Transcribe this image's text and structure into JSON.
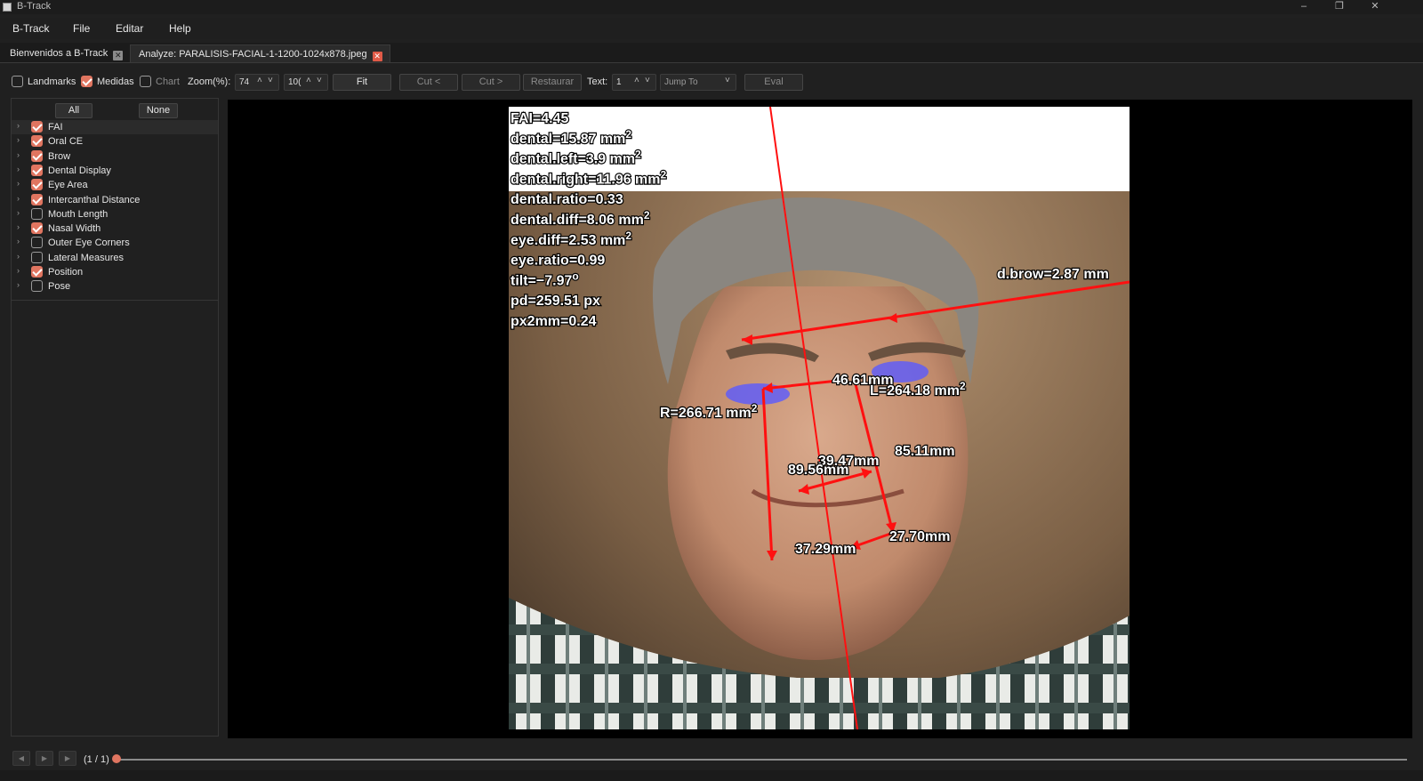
{
  "window": {
    "title": "B-Track",
    "minimize_glyph": "–",
    "restore_glyph": "❐",
    "close_glyph": "✕"
  },
  "menu": [
    "B-Track",
    "File",
    "Editar",
    "Help"
  ],
  "tabs": [
    {
      "label": "Bienvenidos a B-Track",
      "close_glyph": "✕"
    },
    {
      "label": "Analyze: PARALISIS-FACIAL-1-1200-1024x878.jpeg",
      "close_glyph": "✕"
    }
  ],
  "toolbar": {
    "landmarks": {
      "label": "Landmarks",
      "checked": false
    },
    "medidas": {
      "label": "Medidas",
      "checked": true
    },
    "chart": {
      "label": "Chart",
      "checked": false
    },
    "zoom_label": "Zoom(%):",
    "zoom_value": "74",
    "zoom_value2": "10(",
    "fit": "Fit",
    "cut_prev": "Cut <",
    "cut_next": "Cut >",
    "restaurar": "Restaurar",
    "text_label": "Text:",
    "text_value": "1",
    "jump_to": "Jump To",
    "eval": "Eval",
    "arrow_up": "˄",
    "arrow_down": "˅"
  },
  "sidebar": {
    "all": "All",
    "none": "None",
    "expand_glyph": "›",
    "items": [
      {
        "label": "FAI",
        "checked": true
      },
      {
        "label": "Oral CE",
        "checked": true
      },
      {
        "label": "Brow",
        "checked": true
      },
      {
        "label": "Dental Display",
        "checked": true
      },
      {
        "label": "Eye Area",
        "checked": true
      },
      {
        "label": "Intercanthal Distance",
        "checked": true
      },
      {
        "label": "Mouth Length",
        "checked": false
      },
      {
        "label": "Nasal Width",
        "checked": true
      },
      {
        "label": "Outer Eye Corners",
        "checked": false
      },
      {
        "label": "Lateral Measures",
        "checked": false
      },
      {
        "label": "Position",
        "checked": true
      },
      {
        "label": "Pose",
        "checked": false
      }
    ]
  },
  "overlay": {
    "stats": [
      {
        "text": "FAI=4.45",
        "sup": ""
      },
      {
        "text": "dental=15.87 mm",
        "sup": "2"
      },
      {
        "text": "dental.left=3.9 mm",
        "sup": "2"
      },
      {
        "text": "dental.right=11.96 mm",
        "sup": "2"
      },
      {
        "text": "dental.ratio=0.33",
        "sup": ""
      },
      {
        "text": "dental.diff=8.06 mm",
        "sup": "2"
      },
      {
        "text": "eye.diff=2.53 mm",
        "sup": "2"
      },
      {
        "text": "eye.ratio=0.99",
        "sup": ""
      },
      {
        "text": "tilt=−7.97",
        "sup": "o"
      },
      {
        "text": "pd=259.51 px",
        "sup": ""
      },
      {
        "text": "px2mm=0.24",
        "sup": ""
      }
    ],
    "labels": {
      "dbrow": "d.brow=2.87 mm",
      "intercanthal": "46.61mm",
      "left_eye": "L=264.18 mm",
      "left_eye_sup": "2",
      "right_eye": "R=266.71 mm",
      "right_eye_sup": "2",
      "nasal": "39.47mm",
      "right_vertical": "89.56mm",
      "left_vertical": "85.11mm",
      "left_oral": "27.70mm",
      "right_oral": "37.29mm"
    }
  },
  "bottom": {
    "frame": "(1 / 1)",
    "position": 0,
    "prev_glyph": "◀",
    "play_glyph": "▶",
    "next_glyph": "▶"
  },
  "colors": {
    "accent": "#e07560",
    "measure_line": "#ff1010",
    "eye_overlay": "#5a5aff"
  }
}
